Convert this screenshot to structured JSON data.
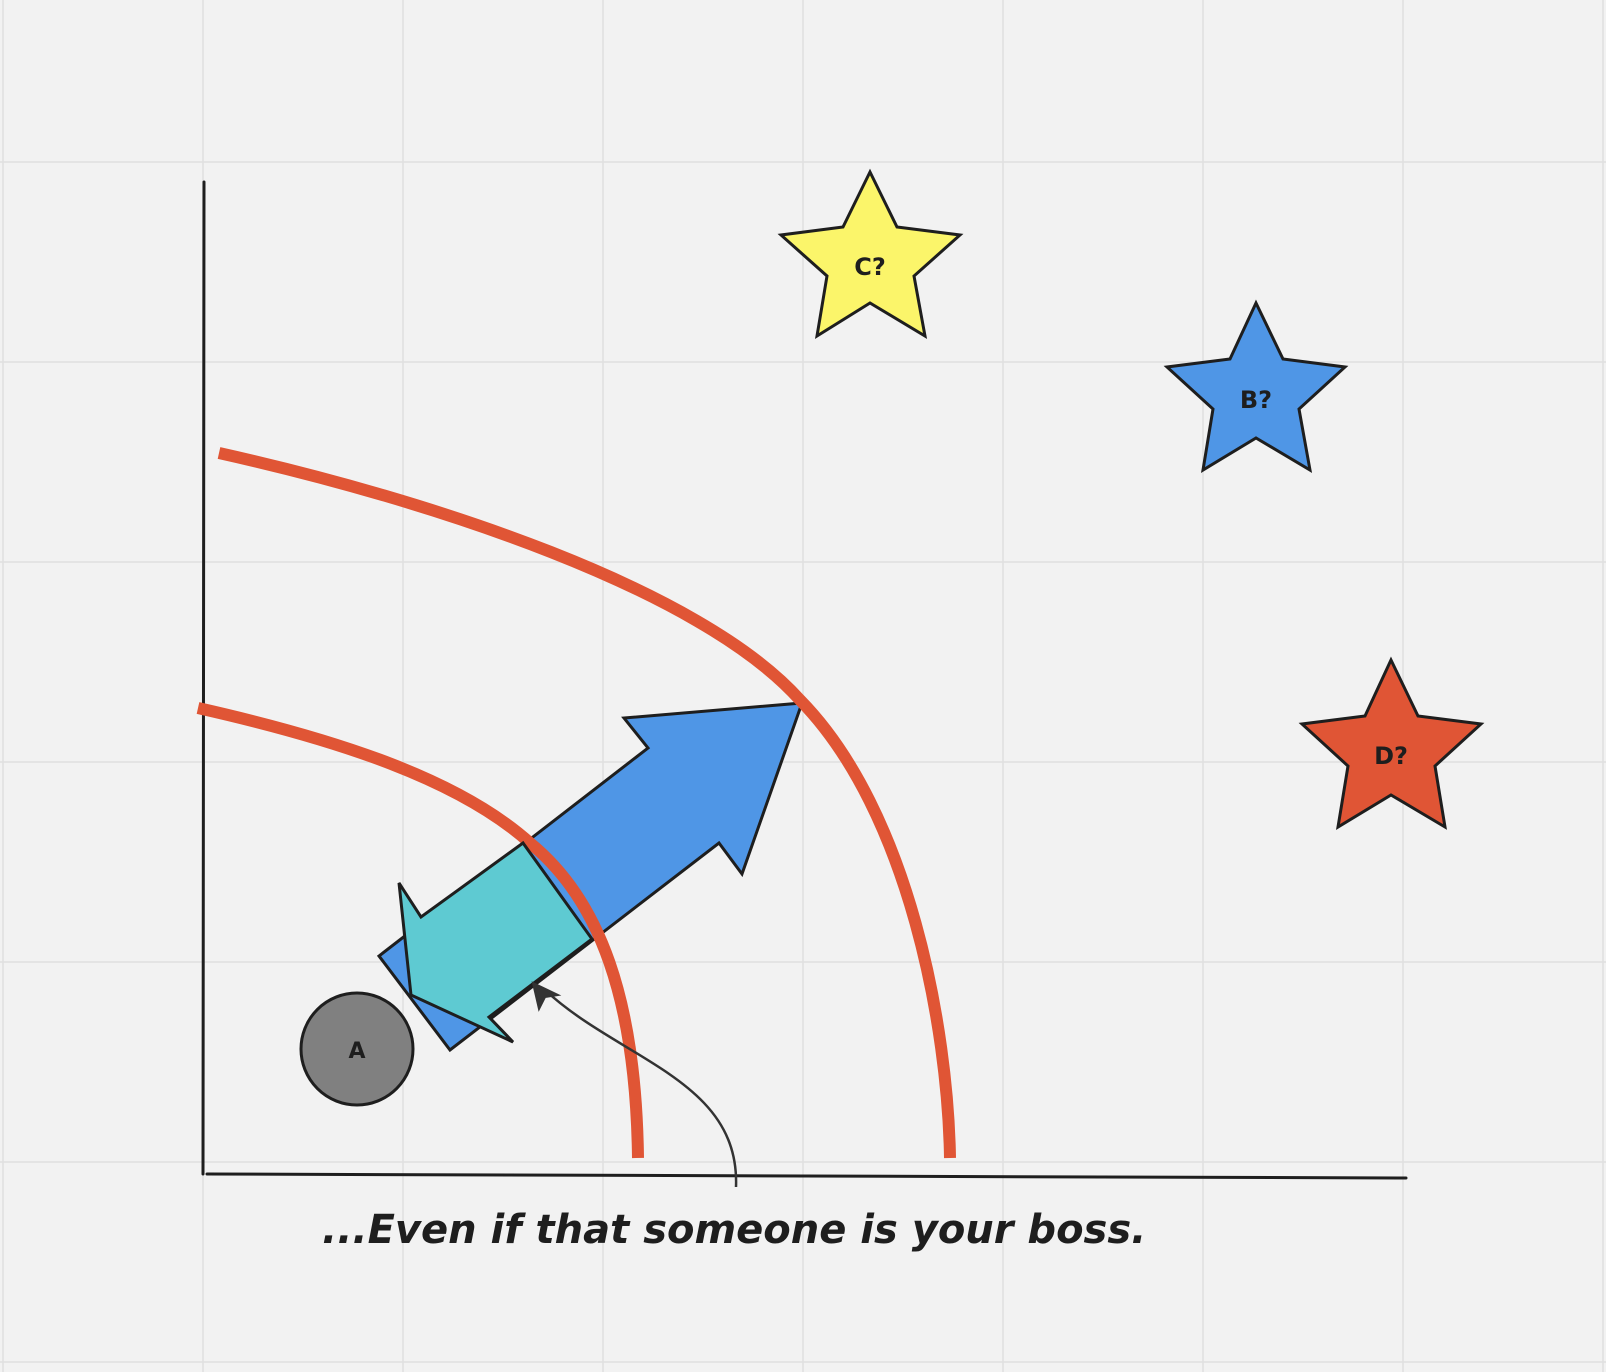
{
  "canvas": {
    "background": "#f2f2f2",
    "grid_color": "#e0e0e0"
  },
  "colors": {
    "curve": "#e05535",
    "big_arrow": "#4f96e6",
    "small_arrow": "#5ecad2",
    "circle": "#808080",
    "star_c": "#fbf56a",
    "star_b": "#4f96e6",
    "star_d": "#e05535",
    "stroke": "#1e1e1e"
  },
  "nodes": {
    "a": {
      "label": "A"
    },
    "c": {
      "label": "C?"
    },
    "b": {
      "label": "B?"
    },
    "d": {
      "label": "D?"
    }
  },
  "caption": "...Even if that someone is your boss."
}
